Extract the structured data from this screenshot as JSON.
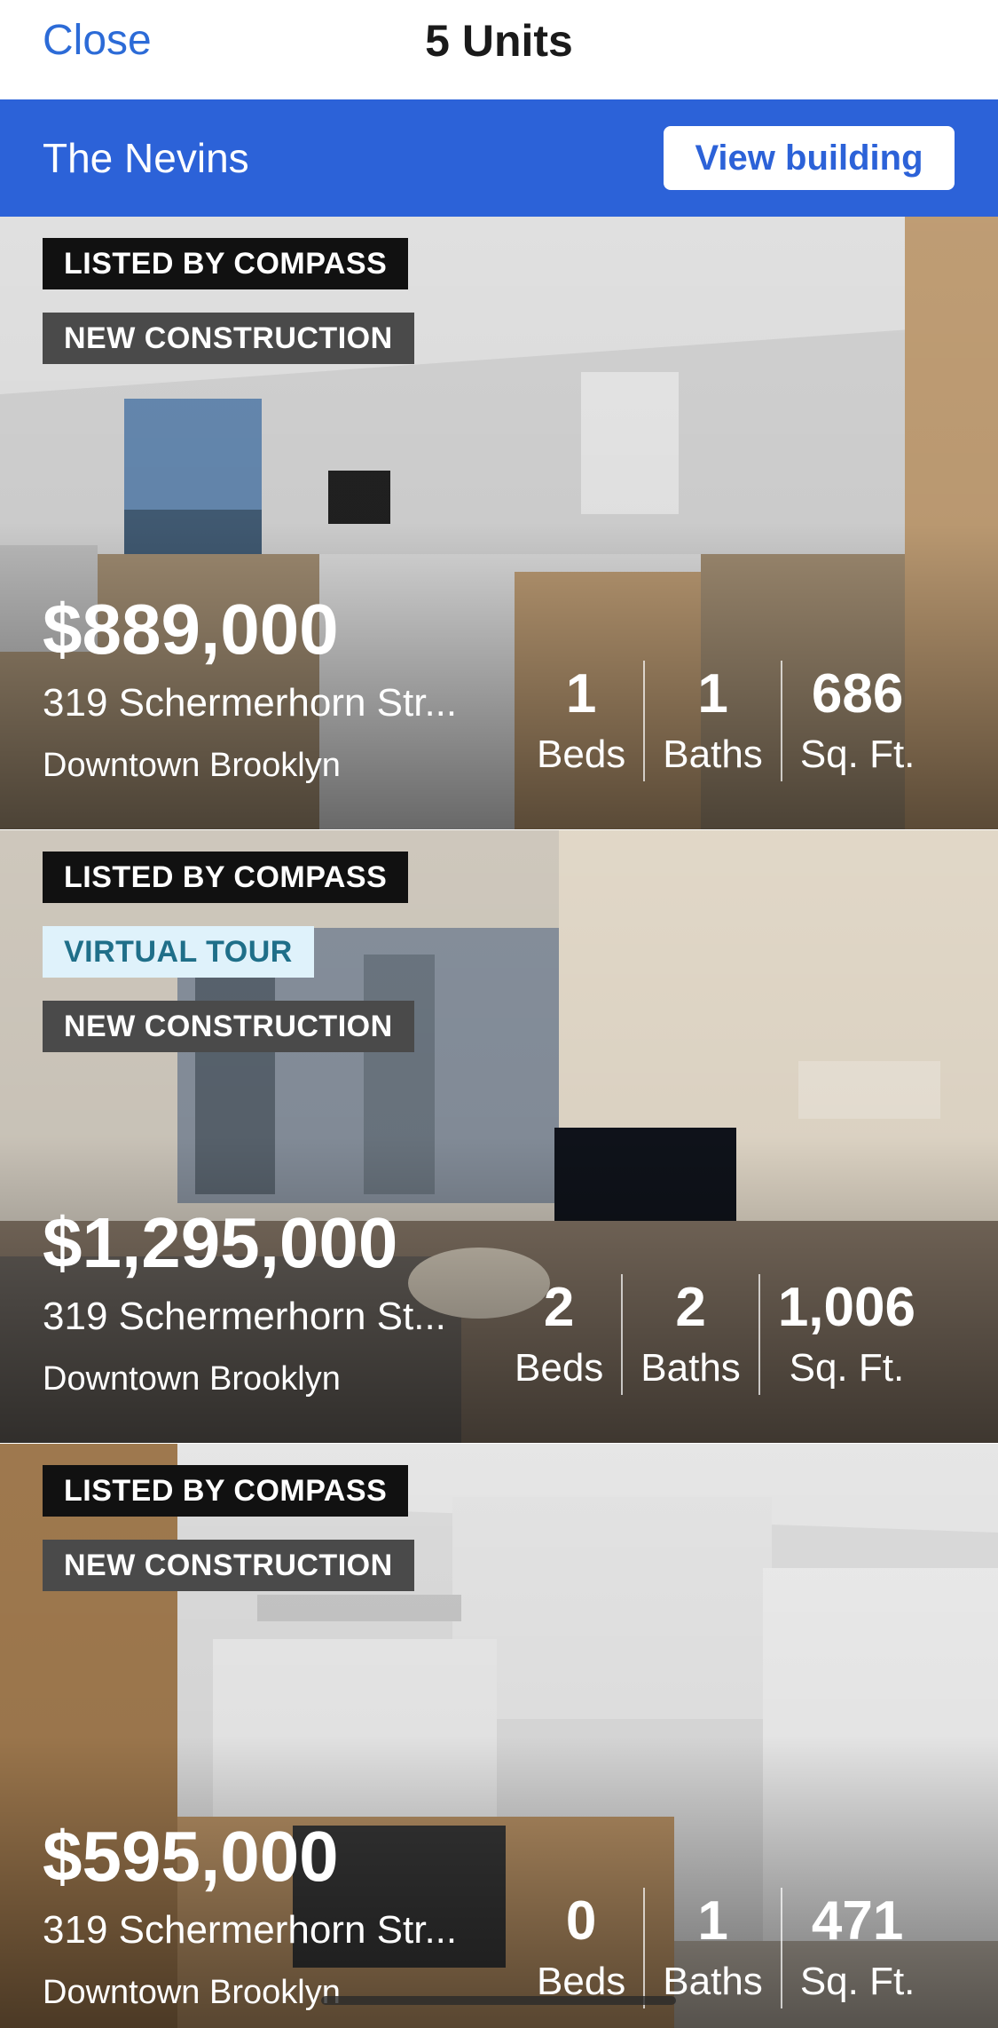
{
  "nav": {
    "close_label": "Close",
    "title": "5 Units"
  },
  "building": {
    "name": "The Nevins",
    "view_button": "View building"
  },
  "listings": [
    {
      "badges": [
        "LISTED BY COMPASS",
        "NEW CONSTRUCTION"
      ],
      "price": "$889,000",
      "address": "319 Schermerhorn Str...",
      "neighborhood": "Downtown Brooklyn",
      "beds": "1",
      "baths": "1",
      "sqft": "686",
      "beds_label": "Beds",
      "baths_label": "Baths",
      "sqft_label": "Sq. Ft."
    },
    {
      "badges": [
        "LISTED BY COMPASS",
        "VIRTUAL TOUR",
        "NEW CONSTRUCTION"
      ],
      "price": "$1,295,000",
      "address": "319 Schermerhorn St...",
      "neighborhood": "Downtown Brooklyn",
      "beds": "2",
      "baths": "2",
      "sqft": "1,006",
      "beds_label": "Beds",
      "baths_label": "Baths",
      "sqft_label": "Sq. Ft."
    },
    {
      "badges": [
        "LISTED BY COMPASS",
        "NEW CONSTRUCTION"
      ],
      "price": "$595,000",
      "address": "319 Schermerhorn Str...",
      "neighborhood": "Downtown Brooklyn",
      "beds": "0",
      "baths": "1",
      "sqft": "471",
      "beds_label": "Beds",
      "baths_label": "Baths",
      "sqft_label": "Sq. Ft."
    }
  ],
  "colors": {
    "accent": "#2c62d8",
    "link": "#2c6bd7"
  }
}
